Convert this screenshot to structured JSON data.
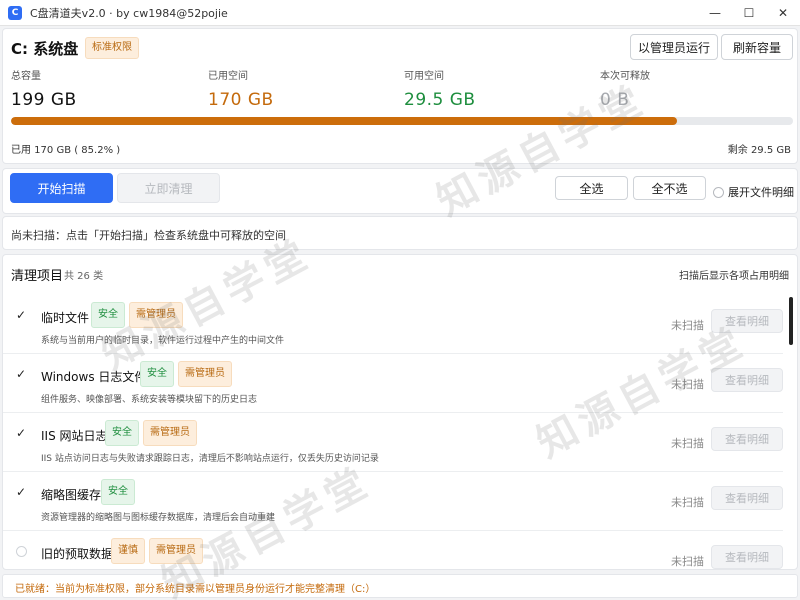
{
  "window": {
    "title": "C盘清道夫v2.0 · by cw1984@52pojie",
    "icon_letter": "C",
    "minimize": "—",
    "maximize": "☐",
    "close": "✕"
  },
  "disk": {
    "name": "C: 系统盘",
    "permission_badge": "标准权限",
    "run_as_admin_label": "以管理员运行",
    "refresh_label": "刷新容量",
    "stats": [
      {
        "label": "总容量",
        "value": "199 GB",
        "color": "#111111"
      },
      {
        "label": "已用空间",
        "value": "170 GB",
        "color": "#c46a0c"
      },
      {
        "label": "可用空间",
        "value": "29.5 GB",
        "color": "#1e8e3e"
      },
      {
        "label": "本次可释放",
        "value": "0 B",
        "color": "#a8abb0"
      }
    ],
    "used_percent": 85.2,
    "used_text": "已用 170 GB ( 85.2% )",
    "remaining_text": "剩余 29.5 GB",
    "progress_color": "#cc6d0b"
  },
  "actions": {
    "start_scan_label": "开始扫描",
    "clean_now_label": "立即清理",
    "select_all_label": "全选",
    "select_none_label": "全不选",
    "expand_details_label": "展开文件明细"
  },
  "status": {
    "text": "尚未扫描：点击「开始扫描」检查系统盘中可释放的空间"
  },
  "items_section": {
    "title": "清理项目",
    "count": "共 26 类",
    "hint": "扫描后显示各项占用明细",
    "detail_label": "查看明细",
    "items": [
      {
        "name": "临时文件",
        "checked": true,
        "badges": [
          {
            "text": "安全",
            "kind": "green"
          },
          {
            "text": "需管理员",
            "kind": "orange"
          }
        ],
        "desc": "系统与当前用户的临时目录，软件运行过程中产生的中间文件",
        "status": "未扫描"
      },
      {
        "name": "Windows 日志文件",
        "checked": true,
        "badges": [
          {
            "text": "安全",
            "kind": "green"
          },
          {
            "text": "需管理员",
            "kind": "orange"
          }
        ],
        "desc": "组件服务、映像部署、系统安装等模块留下的历史日志",
        "status": "未扫描"
      },
      {
        "name": "IIS 网站日志",
        "checked": true,
        "badges": [
          {
            "text": "安全",
            "kind": "green"
          },
          {
            "text": "需管理员",
            "kind": "orange"
          }
        ],
        "desc": "IIS 站点访问日志与失败请求跟踪日志，清理后不影响站点运行，仅丢失历史访问记录",
        "status": "未扫描"
      },
      {
        "name": "缩略图缓存",
        "checked": true,
        "badges": [
          {
            "text": "安全",
            "kind": "green"
          }
        ],
        "desc": "资源管理器的缩略图与图标缓存数据库，清理后会自动重建",
        "status": "未扫描"
      },
      {
        "name": "旧的预取数据",
        "checked": false,
        "badges": [
          {
            "text": "谨慎",
            "kind": "orange"
          },
          {
            "text": "需管理员",
            "kind": "orange"
          }
        ],
        "desc": "",
        "status": "未扫描"
      }
    ]
  },
  "footer": {
    "text": "已就绪：当前为标准权限，部分系统目录需以管理员身份运行才能完整清理（C:）"
  },
  "watermark": {
    "text": "知源自学堂"
  },
  "colors": {
    "accent": "#2f6df4",
    "warning": "#c46a0c",
    "safe": "#1e8e3e"
  }
}
